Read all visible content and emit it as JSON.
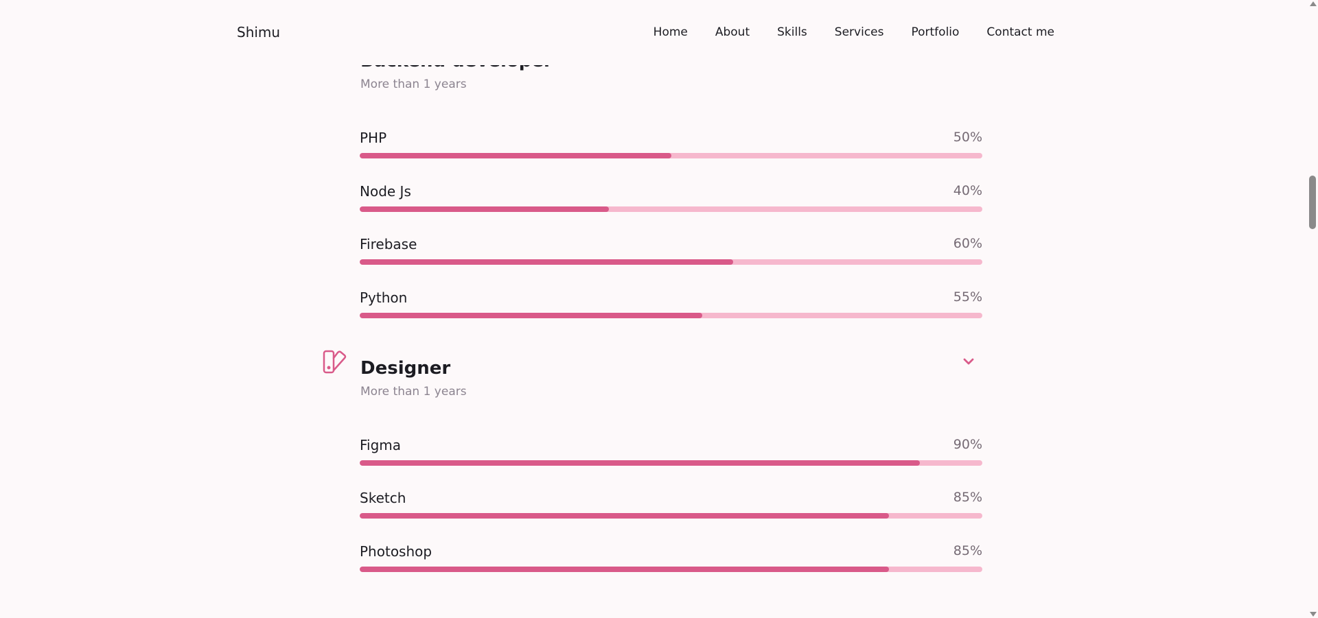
{
  "brand": "Shimu",
  "nav": [
    "Home",
    "About",
    "Skills",
    "Services",
    "Portfolio",
    "Contact me"
  ],
  "accent": "#d95a89",
  "track": "#f6b8cd",
  "sections": [
    {
      "title": "Backend developer",
      "subtitle": "More than 1 years",
      "icon": "server-network-icon",
      "skills": [
        {
          "name": "PHP",
          "pct_label": "50%",
          "value": 50
        },
        {
          "name": "Node Js",
          "pct_label": "40%",
          "value": 40
        },
        {
          "name": "Firebase",
          "pct_label": "60%",
          "value": 60
        },
        {
          "name": "Python",
          "pct_label": "55%",
          "value": 55
        }
      ]
    },
    {
      "title": "Designer",
      "subtitle": "More than 1 years",
      "icon": "swatchbook-icon",
      "skills": [
        {
          "name": "Figma",
          "pct_label": "90%",
          "value": 90
        },
        {
          "name": "Sketch",
          "pct_label": "85%",
          "value": 85
        },
        {
          "name": "Photoshop",
          "pct_label": "85%",
          "value": 85
        }
      ]
    }
  ]
}
